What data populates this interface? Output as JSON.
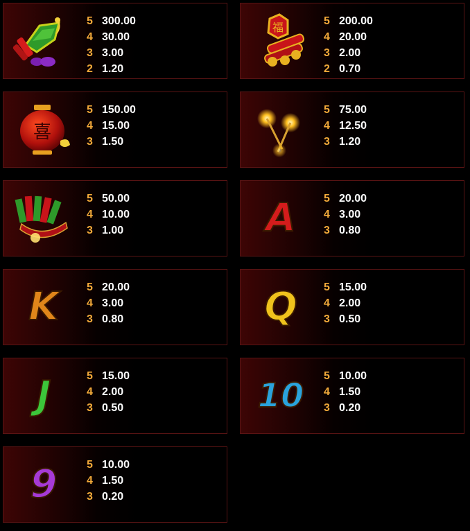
{
  "symbols": [
    {
      "id": "firecracker-bundle",
      "icon": "firecracker-bundle-icon",
      "pays": [
        {
          "count": "5",
          "amount": "300.00"
        },
        {
          "count": "4",
          "amount": "30.00"
        },
        {
          "count": "3",
          "amount": "3.00"
        },
        {
          "count": "2",
          "amount": "1.20"
        }
      ]
    },
    {
      "id": "fu-firecrackers",
      "icon": "fu-firecrackers-icon",
      "pays": [
        {
          "count": "5",
          "amount": "200.00"
        },
        {
          "count": "4",
          "amount": "20.00"
        },
        {
          "count": "3",
          "amount": "2.00"
        },
        {
          "count": "2",
          "amount": "0.70"
        }
      ]
    },
    {
      "id": "red-lantern",
      "icon": "red-lantern-icon",
      "pays": [
        {
          "count": "5",
          "amount": "150.00"
        },
        {
          "count": "4",
          "amount": "15.00"
        },
        {
          "count": "3",
          "amount": "1.50"
        }
      ]
    },
    {
      "id": "sparklers",
      "icon": "sparklers-icon",
      "pays": [
        {
          "count": "5",
          "amount": "75.00"
        },
        {
          "count": "4",
          "amount": "12.50"
        },
        {
          "count": "3",
          "amount": "1.20"
        }
      ]
    },
    {
      "id": "firecracker-fan",
      "icon": "firecracker-fan-icon",
      "pays": [
        {
          "count": "5",
          "amount": "50.00"
        },
        {
          "count": "4",
          "amount": "10.00"
        },
        {
          "count": "3",
          "amount": "1.00"
        }
      ]
    },
    {
      "id": "letter-a",
      "icon": "letter-a-icon",
      "glyph": "A",
      "color": "#d41c1c",
      "pays": [
        {
          "count": "5",
          "amount": "20.00"
        },
        {
          "count": "4",
          "amount": "3.00"
        },
        {
          "count": "3",
          "amount": "0.80"
        }
      ]
    },
    {
      "id": "letter-k",
      "icon": "letter-k-icon",
      "glyph": "K",
      "color": "#e0861a",
      "pays": [
        {
          "count": "5",
          "amount": "20.00"
        },
        {
          "count": "4",
          "amount": "3.00"
        },
        {
          "count": "3",
          "amount": "0.80"
        }
      ]
    },
    {
      "id": "letter-q",
      "icon": "letter-q-icon",
      "glyph": "Q",
      "color": "#f0c21c",
      "pays": [
        {
          "count": "5",
          "amount": "15.00"
        },
        {
          "count": "4",
          "amount": "2.00"
        },
        {
          "count": "3",
          "amount": "0.50"
        }
      ]
    },
    {
      "id": "letter-j",
      "icon": "letter-j-icon",
      "glyph": "J",
      "color": "#3cc63a",
      "pays": [
        {
          "count": "5",
          "amount": "15.00"
        },
        {
          "count": "4",
          "amount": "2.00"
        },
        {
          "count": "3",
          "amount": "0.50"
        }
      ]
    },
    {
      "id": "number-10",
      "icon": "number-10-icon",
      "glyph": "10",
      "color": "#2aa3dc",
      "pays": [
        {
          "count": "5",
          "amount": "10.00"
        },
        {
          "count": "4",
          "amount": "1.50"
        },
        {
          "count": "3",
          "amount": "0.20"
        }
      ]
    },
    {
      "id": "number-9",
      "icon": "number-9-icon",
      "glyph": "9",
      "color": "#a63ad6",
      "pays": [
        {
          "count": "5",
          "amount": "10.00"
        },
        {
          "count": "4",
          "amount": "1.50"
        },
        {
          "count": "3",
          "amount": "0.20"
        }
      ]
    }
  ],
  "colors": {
    "count": "#f2a93a",
    "amount": "#ffffff",
    "border": "#5a1414",
    "background": "#000000"
  },
  "lantern_character": "喜",
  "fu_character": "福"
}
